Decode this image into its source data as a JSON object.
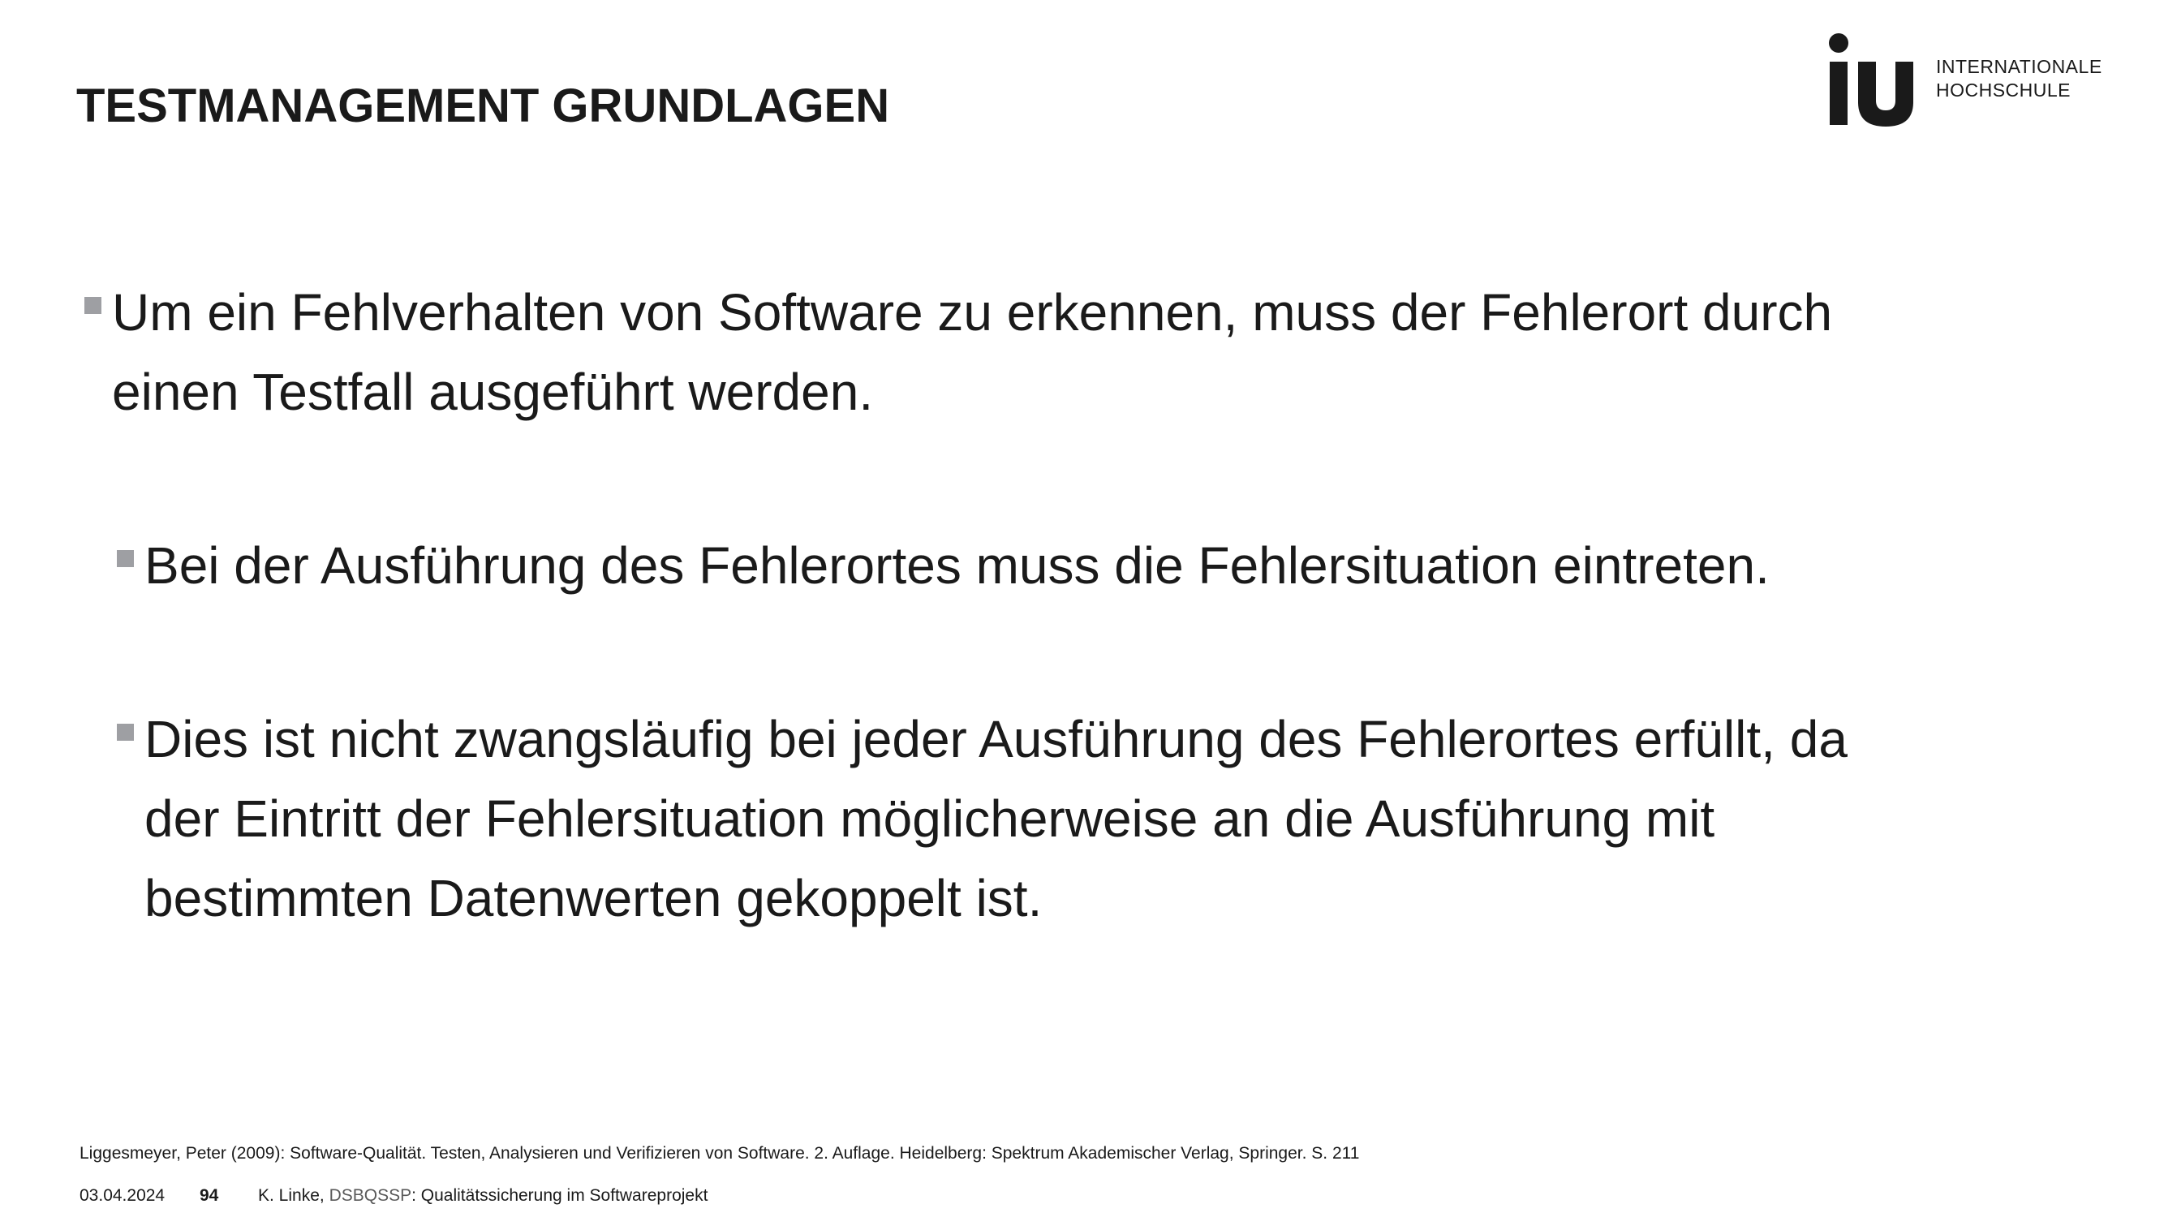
{
  "header": {
    "title": "TESTMANAGEMENT GRUNDLAGEN"
  },
  "logo": {
    "mark": "iu",
    "line1": "INTERNATIONALE",
    "line2": "HOCHSCHULE"
  },
  "content": {
    "bullets": [
      {
        "level": 1,
        "lines": [
          "Um ein Fehlverhalten von Software zu erkennen, muss der Fehlerort durch",
          "einen Testfall ausgeführt werden."
        ]
      },
      {
        "level": 2,
        "lines": [
          "Bei der Ausführung des Fehlerortes muss die Fehlersituation eintreten."
        ]
      },
      {
        "level": 2,
        "lines": [
          "Dies ist nicht zwangsläufig bei jeder Ausführung des Fehlerortes erfüllt, da",
          "der Eintritt der Fehlersituation möglicherweise an die Ausführung mit",
          "bestimmten Datenwerten gekoppelt ist."
        ]
      }
    ]
  },
  "reference": "Liggesmeyer, Peter (2009): Software-Qualität. Testen, Analysieren und Verifizieren von Software. 2. Auflage. Heidelberg: Spektrum Akademischer Verlag, Springer. S. 211",
  "footer": {
    "date": "03.04.2024",
    "page_number": "94",
    "author_prefix": "K. Linke, ",
    "course_code": "DSBQSSP",
    "course_title": ": Qualitätssicherung im Softwareprojekt"
  },
  "colors": {
    "text": "#1a1a1a",
    "bullet_marker": "#9e9fa3",
    "course_code": "#5a5a5a",
    "background": "#ffffff"
  }
}
